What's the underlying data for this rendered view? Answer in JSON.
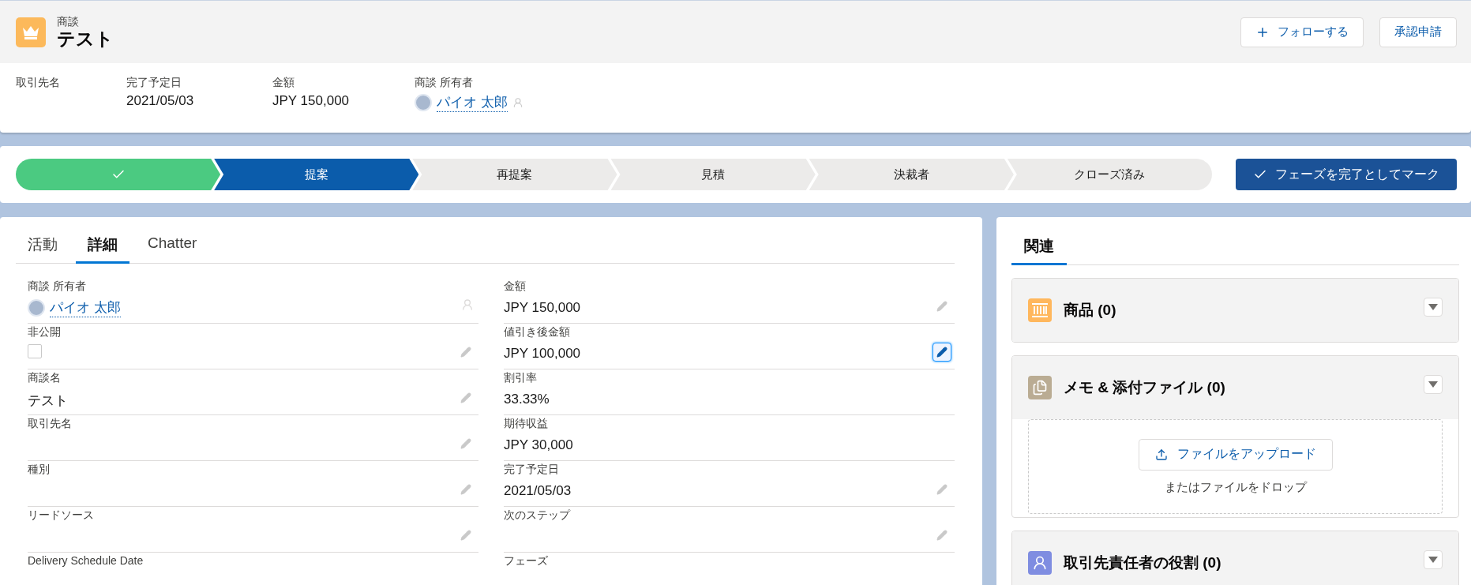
{
  "header": {
    "object_label": "商談",
    "record_name": "テスト",
    "buttons": [
      {
        "label": "フォローする",
        "kind": "follow"
      },
      {
        "label": "承認申請",
        "kind": "plain"
      }
    ]
  },
  "highlights": [
    {
      "label": "取引先名",
      "kind": "text"
    },
    {
      "label": "完了予定日",
      "value": "2021/05/03",
      "kind": "text"
    },
    {
      "label": "金額",
      "value": "JPY 150,000",
      "kind": "text"
    },
    {
      "label": "商談 所有者",
      "value": "パイオ 太郎",
      "kind": "user"
    }
  ],
  "path": {
    "stages": [
      {
        "completed": true,
        "selected": false
      },
      {
        "label": "提案",
        "completed": false,
        "selected": true
      },
      {
        "label": "再提案",
        "completed": false,
        "selected": false
      },
      {
        "label": "見積",
        "completed": false,
        "selected": false
      },
      {
        "label": "決裁者",
        "completed": false,
        "selected": false
      },
      {
        "label": "クローズ済み",
        "completed": false,
        "selected": false
      }
    ],
    "mark_button": "フェーズを完了としてマーク"
  },
  "tabs": [
    {
      "label": "活動",
      "selected": false
    },
    {
      "label": "詳細",
      "selected": true
    },
    {
      "label": "Chatter",
      "selected": false
    }
  ],
  "fields_left": [
    {
      "label": "商談 所有者",
      "value": "パイオ 太郎",
      "kind": "user",
      "editable": false
    },
    {
      "label": "非公開",
      "kind": "checkbox",
      "checked": false,
      "editable": true,
      "focused": false
    },
    {
      "label": "商談名",
      "value": "テスト",
      "kind": "text",
      "editable": true,
      "focused": false
    },
    {
      "label": "取引先名",
      "kind": "text",
      "editable": true,
      "focused": false
    },
    {
      "label": "種別",
      "kind": "text",
      "editable": true,
      "focused": false
    },
    {
      "label": "リードソース",
      "kind": "text",
      "editable": true,
      "focused": false
    },
    {
      "label": "Delivery Schedule Date",
      "kind": "text",
      "editable": false
    }
  ],
  "fields_right": [
    {
      "label": "金額",
      "value": "JPY 150,000",
      "kind": "text",
      "editable": true,
      "focused": false
    },
    {
      "label": "値引き後金額",
      "value": "JPY 100,000",
      "kind": "text",
      "editable": true,
      "focused": true
    },
    {
      "label": "割引率",
      "value": "33.33%",
      "kind": "text",
      "editable": false
    },
    {
      "label": "期待収益",
      "value": "JPY 30,000",
      "kind": "text",
      "editable": false
    },
    {
      "label": "完了予定日",
      "value": "2021/05/03",
      "kind": "text",
      "editable": true,
      "focused": false
    },
    {
      "label": "次のステップ",
      "kind": "text",
      "editable": true,
      "focused": false
    },
    {
      "label": "フェーズ",
      "kind": "text",
      "editable": false
    }
  ],
  "related": {
    "tabs": [
      {
        "label": "関連",
        "selected": true
      }
    ],
    "cards": [
      {
        "title": "商品 (0)",
        "kind": "products",
        "color": "#ffb75d"
      },
      {
        "title": "メモ & 添付ファイル (0)",
        "kind": "files",
        "color": "#baac93",
        "upload_button": "ファイルをアップロード",
        "drop_hint": "またはファイルをドロップ"
      },
      {
        "title": "取引先責任者の役割 (0)",
        "kind": "contact",
        "color": "#7f8de1"
      }
    ]
  }
}
